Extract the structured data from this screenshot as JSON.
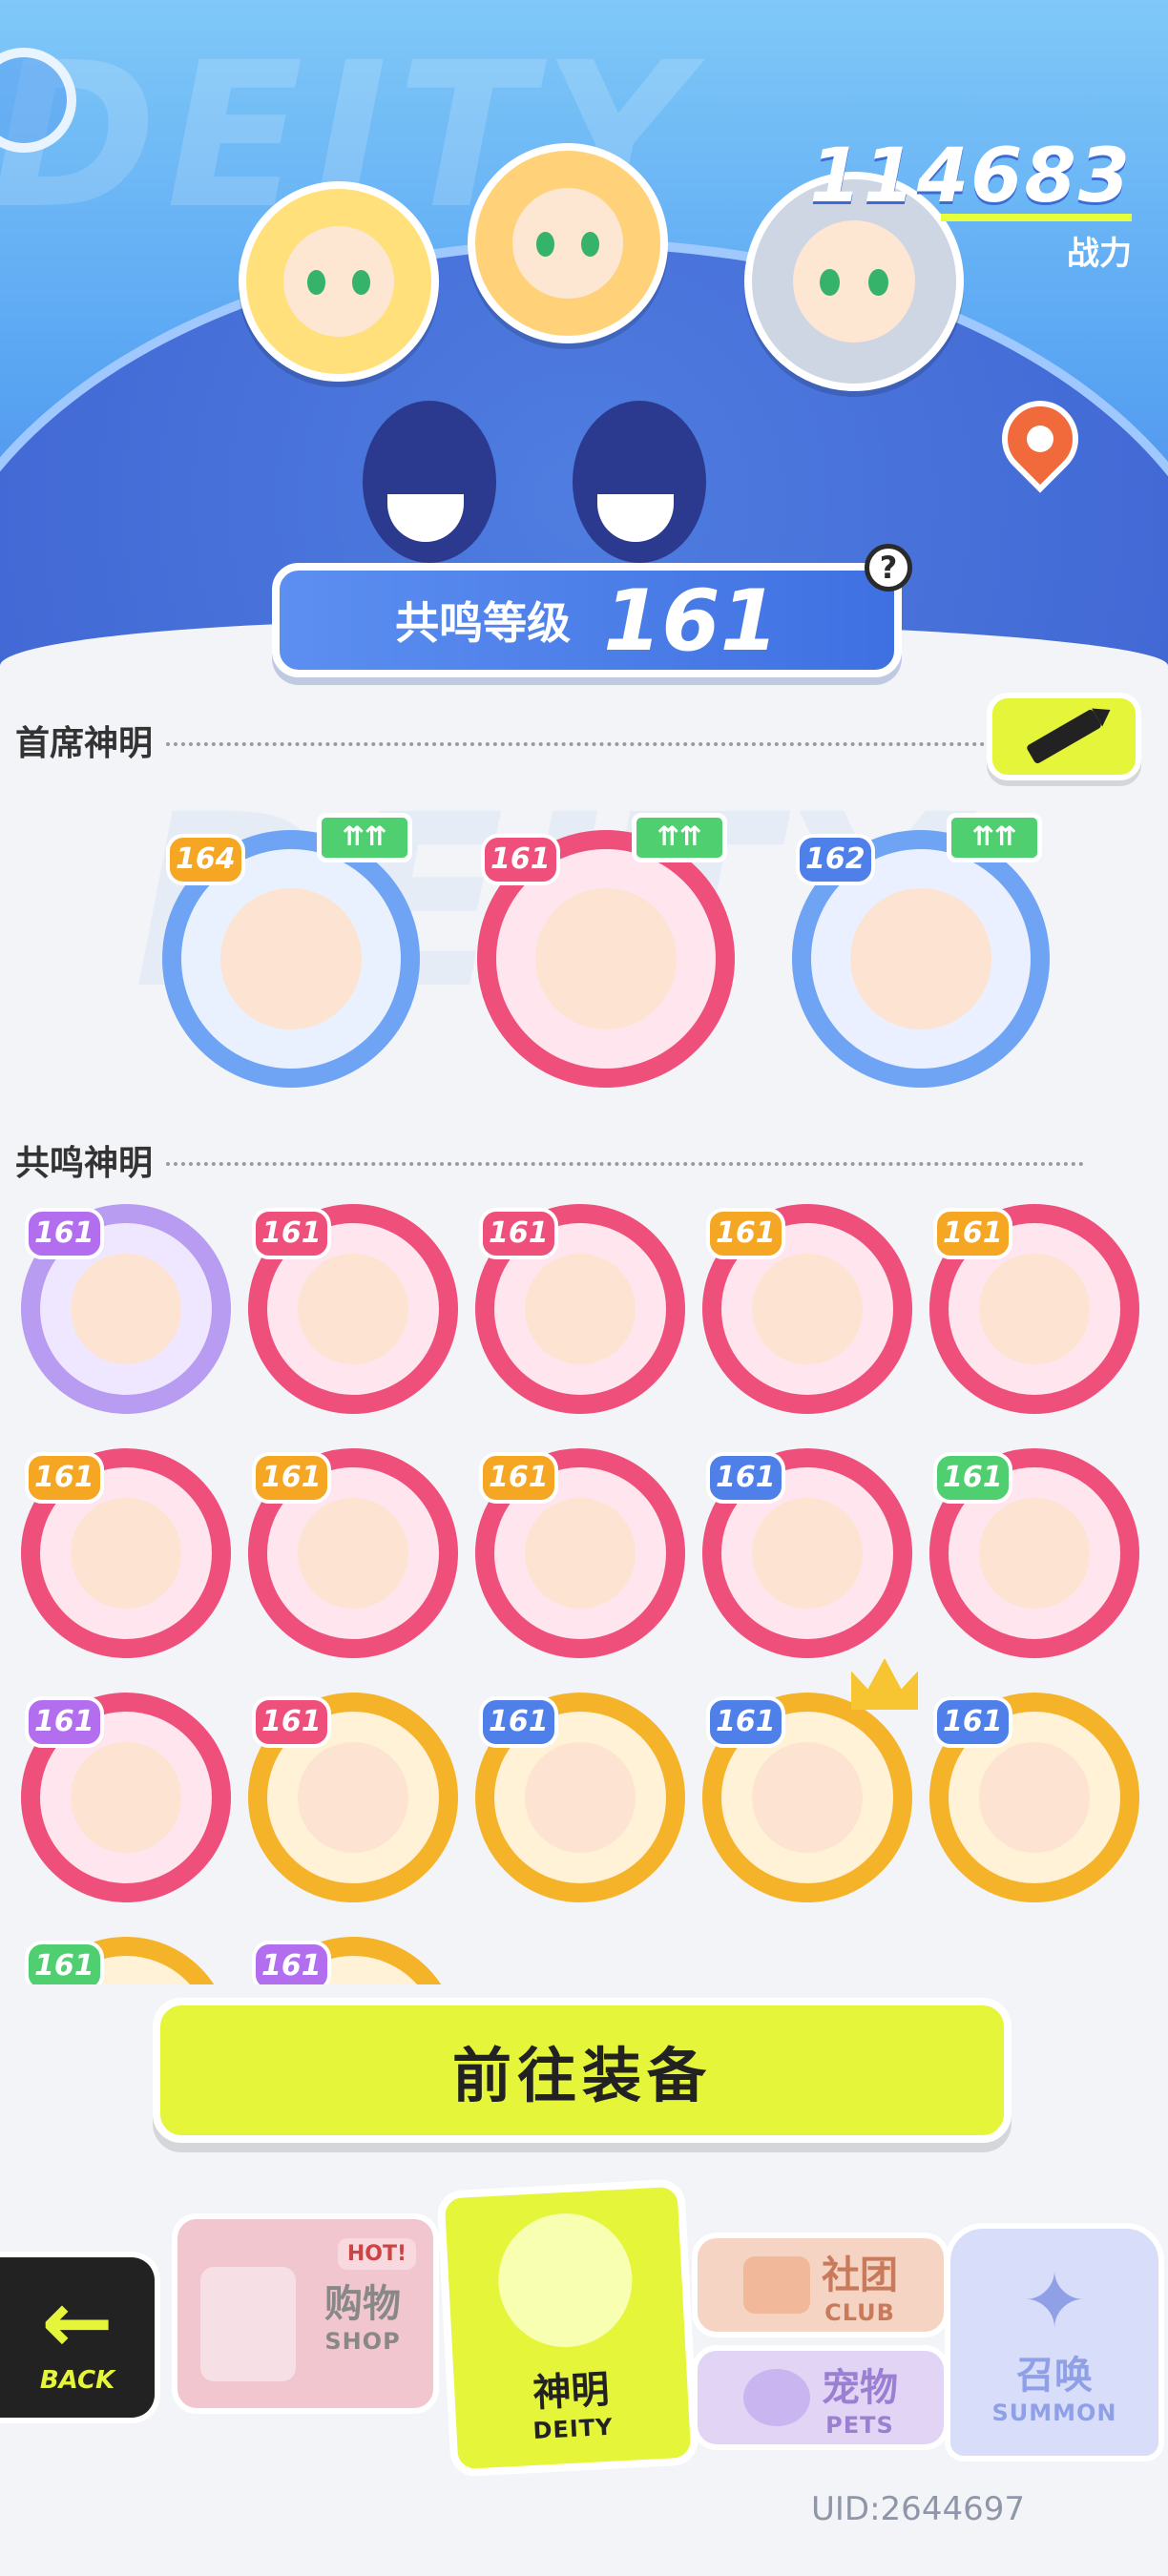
{
  "header": {
    "power_value": "114683",
    "power_label": "战力",
    "resonance_label": "共鸣等级",
    "resonance_level": "161",
    "help": "?"
  },
  "featured": {
    "title": "首席神明",
    "upgrade_icon": "upgrade-arrows-icon",
    "cards": [
      {
        "level": "164",
        "ring": "#6fa4f5",
        "inner": "#e9f1ff",
        "badge": "#f5a623"
      },
      {
        "level": "161",
        "ring": "#ee4f7b",
        "inner": "#ffe6ee",
        "badge": "#ee4f7b"
      },
      {
        "level": "162",
        "ring": "#6fa4f5",
        "inner": "#eaf0ff",
        "badge": "#4f7fe8"
      }
    ]
  },
  "resonance": {
    "title": "共鸣神明",
    "cards": [
      {
        "level": "161",
        "ring": "#b79cf2",
        "inner": "#efe7ff",
        "badge": "#b36ef0"
      },
      {
        "level": "161",
        "ring": "#ee4f7b",
        "inner": "#ffe6ee",
        "badge": "#ee4f7b"
      },
      {
        "level": "161",
        "ring": "#ee4f7b",
        "inner": "#ffe6ee",
        "badge": "#ee4f7b"
      },
      {
        "level": "161",
        "ring": "#ee4f7b",
        "inner": "#ffe6ee",
        "badge": "#f5a623"
      },
      {
        "level": "161",
        "ring": "#ee4f7b",
        "inner": "#ffe6ee",
        "badge": "#f5a623"
      },
      {
        "level": "161",
        "ring": "#ee4f7b",
        "inner": "#ffe6ee",
        "badge": "#f5a623"
      },
      {
        "level": "161",
        "ring": "#ee4f7b",
        "inner": "#ffe6ee",
        "badge": "#f5a623"
      },
      {
        "level": "161",
        "ring": "#ee4f7b",
        "inner": "#ffe6ee",
        "badge": "#f5a623"
      },
      {
        "level": "161",
        "ring": "#ee4f7b",
        "inner": "#ffe6ee",
        "badge": "#4f7fe8"
      },
      {
        "level": "161",
        "ring": "#ee4f7b",
        "inner": "#ffe6ee",
        "badge": "#4fcf6f"
      },
      {
        "level": "161",
        "ring": "#ee4f7b",
        "inner": "#ffe6ee",
        "badge": "#b36ef0"
      },
      {
        "level": "161",
        "ring": "#f5b32a",
        "inner": "#fff2d6",
        "badge": "#ee4f7b"
      },
      {
        "level": "161",
        "ring": "#f5b32a",
        "inner": "#fff2d6",
        "badge": "#4f7fe8"
      },
      {
        "level": "161",
        "ring": "#f5b32a",
        "inner": "#fff2d6",
        "badge": "#4f7fe8",
        "crown": true
      },
      {
        "level": "161",
        "ring": "#f5b32a",
        "inner": "#fff2d6",
        "badge": "#4f7fe8"
      },
      {
        "level": "161",
        "ring": "#f5b32a",
        "inner": "#fff2d6",
        "badge": "#4fcf6f"
      },
      {
        "level": "161",
        "ring": "#f5b32a",
        "inner": "#fff2d6",
        "badge": "#b36ef0"
      }
    ]
  },
  "equip_button": "前往装备",
  "nav": {
    "back": "BACK",
    "shop_badge": "HOT!",
    "shop": "购物",
    "shop_en": "SHOP",
    "deity": "神明",
    "deity_en": "DEITY",
    "club": "社团",
    "club_en": "CLUB",
    "pets": "宠物",
    "pets_en": "PETS",
    "summon": "召唤",
    "summon_en": "SUMMON"
  },
  "uid": "UID:2644697",
  "colors": {
    "accent": "#e5f53a",
    "brand_blue": "#4f7fe8",
    "pink": "#ee4f7b"
  }
}
